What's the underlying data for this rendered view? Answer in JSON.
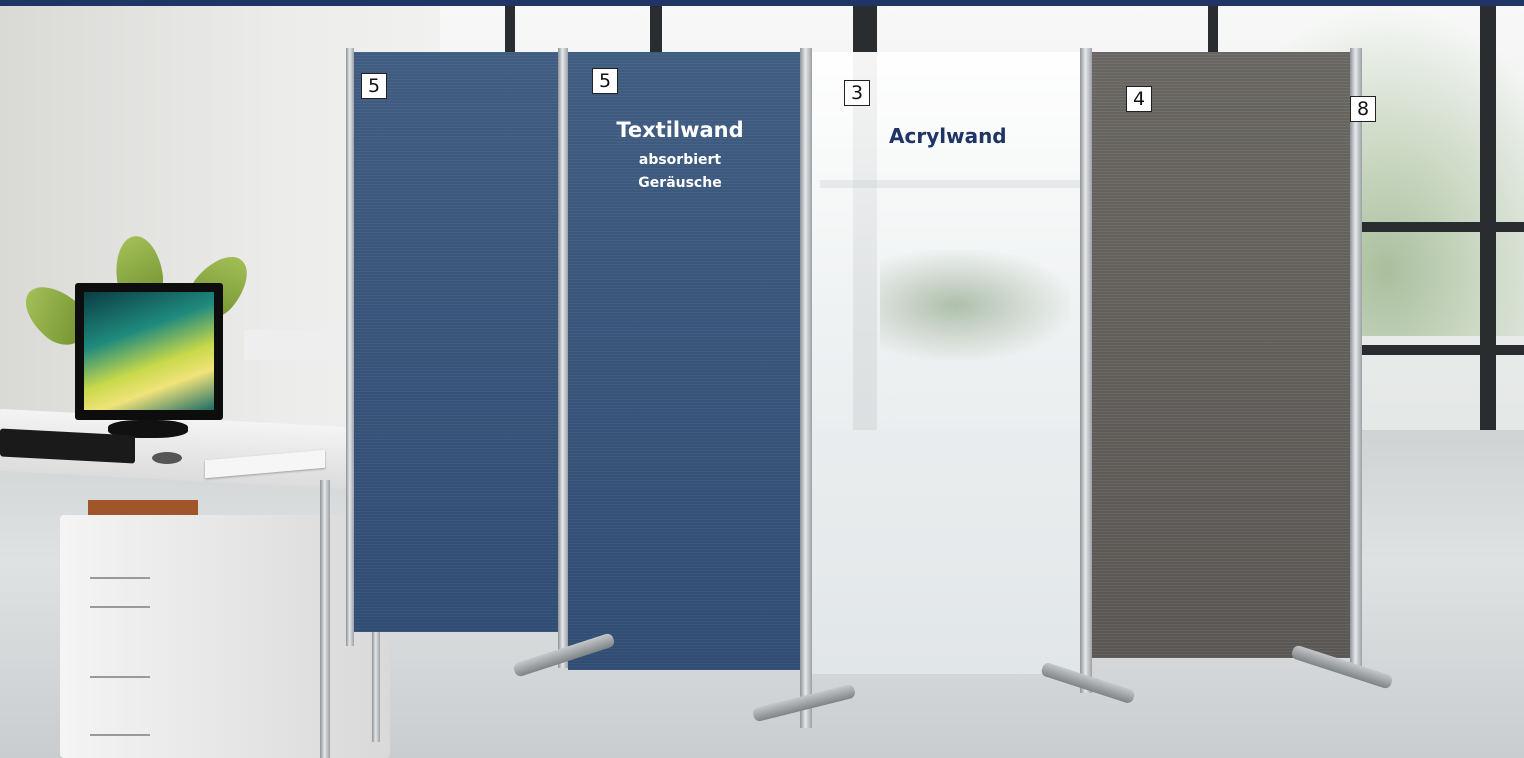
{
  "labels": {
    "panel_1_number": "5",
    "panel_2_number": "5",
    "panel_3_number": "3",
    "panel_4_number": "4",
    "panel_5_number": "8"
  },
  "textile": {
    "title": "Textilwand",
    "line1": "absorbiert",
    "line2": "Geräusche"
  },
  "acrylic": {
    "title": "Acrylwand"
  },
  "colors": {
    "brand_navy": "#1f3566",
    "textile_blue": "#3c587e",
    "textile_grey": "#66635f"
  }
}
